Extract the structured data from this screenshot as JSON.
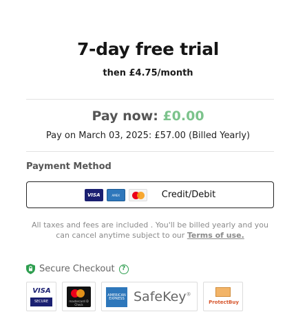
{
  "header": {
    "title": "7-day free trial",
    "subtitle": "then £4.75/month"
  },
  "pricing": {
    "pay_now_label": "Pay now:",
    "pay_now_amount": "£0.00",
    "pay_on_text": "Pay on March 03, 2025: £57.00 (Billed Yearly)"
  },
  "payment_method": {
    "heading": "Payment Method",
    "option_label": "Credit/Debit",
    "card_icons": [
      "visa-icon",
      "amex-icon",
      "mastercard-icon"
    ]
  },
  "notice": {
    "text": "All taxes and fees are included . You'll be billed yearly and you can cancel anytime subject to our",
    "terms_link": "Terms of use."
  },
  "secure": {
    "label": "Secure Checkout",
    "help_glyph": "?"
  },
  "trust_badges": {
    "visa_top": "VISA",
    "visa_bottom": "SECURE",
    "mastercard_text": "mastercard ID Check",
    "amex_text": "AMERICAN EXPRESS",
    "safekey_text": "SafeKey",
    "safekey_mark": "®",
    "protectbuy_text": "ProtectBuy"
  },
  "colors": {
    "accent_green": "#7cc38c",
    "secure_green": "#2e9e4f",
    "visa_blue": "#1a1f71",
    "amex_blue": "#2e77bb"
  }
}
